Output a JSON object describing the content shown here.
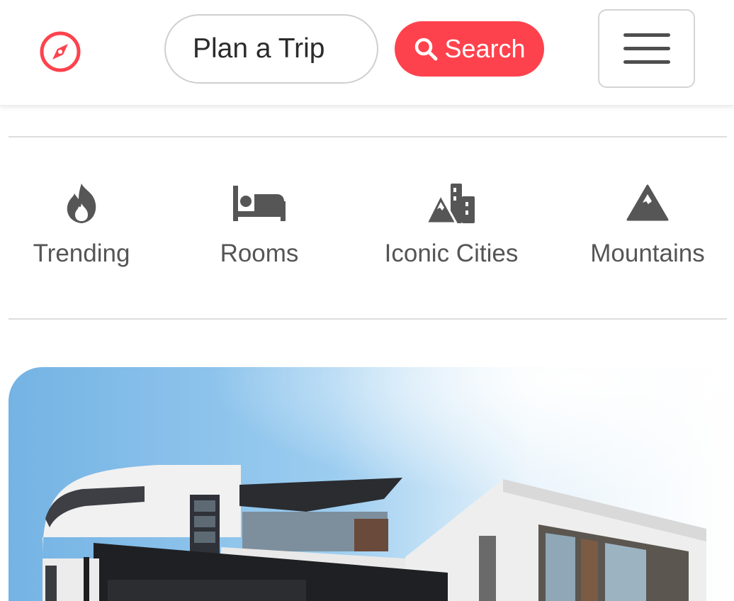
{
  "navbar": {
    "logo_icon": "compass-icon",
    "search_placeholder": "Plan a Trip",
    "search_button": {
      "icon": "search-icon",
      "label": "Search"
    },
    "menu_icon": "hamburger-menu-icon"
  },
  "filters": [
    {
      "icon": "fire-icon",
      "label": "Trending"
    },
    {
      "icon": "bed-icon",
      "label": "Rooms"
    },
    {
      "icon": "city-icon",
      "label": "Iconic Cities"
    },
    {
      "icon": "mountain-icon",
      "label": "Mountains"
    }
  ],
  "colors": {
    "brand": "#fe424d",
    "text": "#555555",
    "border": "#cfcfcf"
  },
  "listing": {
    "image": "modern-house-photo"
  }
}
